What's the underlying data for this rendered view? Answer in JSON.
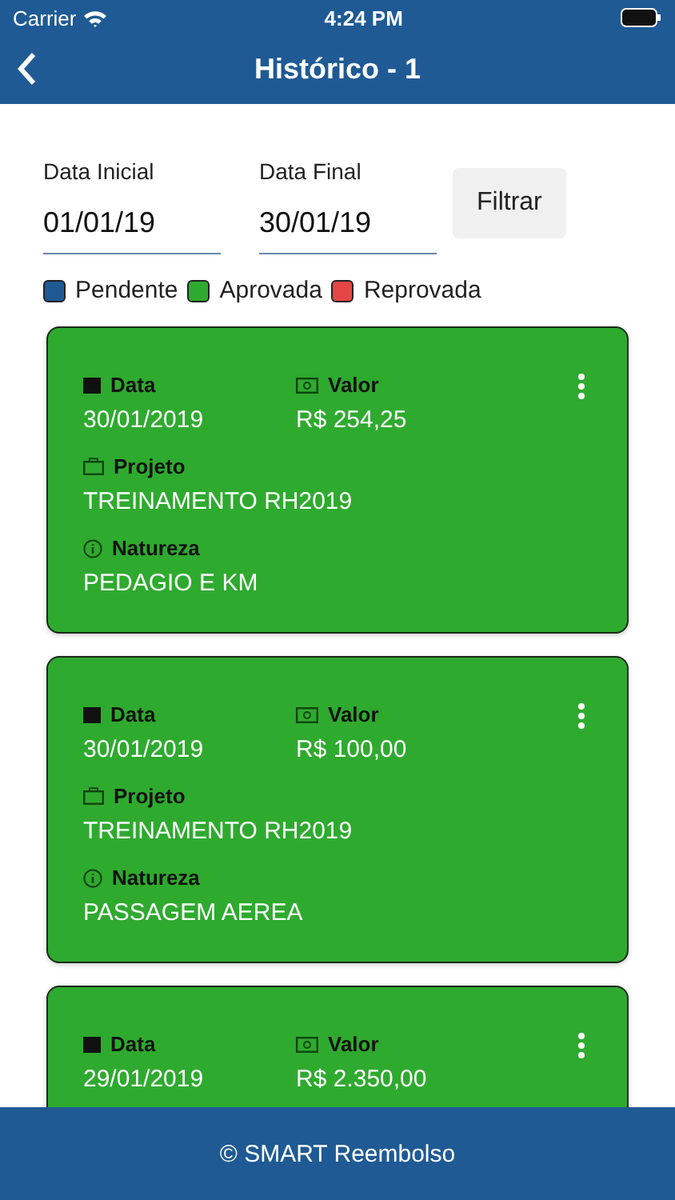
{
  "status_bar": {
    "carrier": "Carrier",
    "time": "4:24 PM"
  },
  "header": {
    "title": "Histórico - 1"
  },
  "filter": {
    "start_label": "Data Inicial",
    "start_value": "01/01/19",
    "end_label": "Data Final",
    "end_value": "30/01/19",
    "button": "Filtrar"
  },
  "legend": [
    {
      "label": "Pendente",
      "color": "#1f5a94"
    },
    {
      "label": "Aprovada",
      "color": "#2eaa2e"
    },
    {
      "label": "Reprovada",
      "color": "#e64545"
    }
  ],
  "cards": [
    {
      "color": "#2eaa2e",
      "data_label": "Data",
      "data": "30/01/2019",
      "valor_label": "Valor",
      "valor": "R$ 254,25",
      "projeto_label": "Projeto",
      "projeto": "TREINAMENTO RH2019",
      "natureza_label": "Natureza",
      "natureza": "PEDAGIO E KM"
    },
    {
      "color": "#2eaa2e",
      "data_label": "Data",
      "data": "30/01/2019",
      "valor_label": "Valor",
      "valor": "R$ 100,00",
      "projeto_label": "Projeto",
      "projeto": "TREINAMENTO RH2019",
      "natureza_label": "Natureza",
      "natureza": "PASSAGEM AEREA"
    },
    {
      "color": "#2eaa2e",
      "data_label": "Data",
      "data": "29/01/2019",
      "valor_label": "Valor",
      "valor": "R$ 2.350,00"
    }
  ],
  "footer": {
    "text": "© SMART Reembolso"
  }
}
